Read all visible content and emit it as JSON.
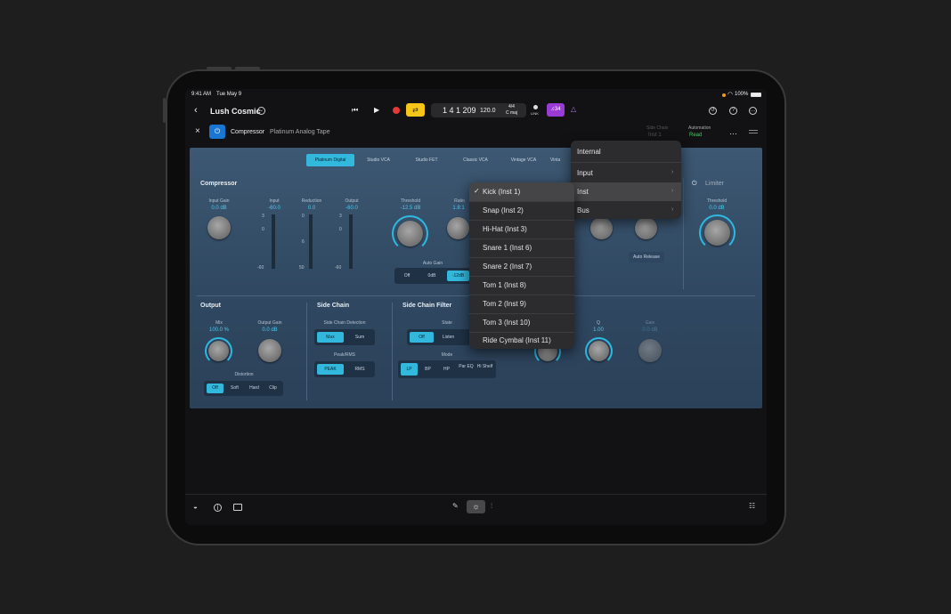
{
  "status": {
    "time": "9:41 AM",
    "date": "Tue May 9",
    "battery": "100%"
  },
  "topbar": {
    "project": "Lush Cosmic",
    "position": "1 4 1 209",
    "tempo": "120.0",
    "signature": "4/4",
    "key": "C maj",
    "link_label": "LINK",
    "count_in": "♫34"
  },
  "plugin_header": {
    "name": "Compressor",
    "preset": "Platinum Analog Tape",
    "sidechain_label": "Side Chain",
    "sidechain_value": "Inst 1",
    "automation_label": "Automation",
    "automation_value": "Read"
  },
  "tabs": [
    "Platinum Digital",
    "Studio VCA",
    "Studio FET",
    "Classic VCA",
    "Vintage VCA",
    "Vinta"
  ],
  "compressor": {
    "title": "Compressor",
    "input_gain": {
      "label": "Input Gain",
      "value": "0.0 dB"
    },
    "input": {
      "label": "Input",
      "value": "-60.0",
      "ticks": [
        "3",
        "0",
        "-60"
      ]
    },
    "reduction": {
      "label": "Reduction",
      "value": "0.0",
      "ticks": [
        "0",
        "6",
        "50"
      ]
    },
    "output": {
      "label": "Output",
      "value": "-60.0",
      "ticks": [
        "3",
        "0",
        "-60"
      ]
    },
    "threshold": {
      "label": "Threshold",
      "value": "-12.5 dB"
    },
    "ratio": {
      "label": "Ratio",
      "value": "1.8:1"
    },
    "auto_gain": {
      "label": "Auto Gain",
      "options": [
        "Off",
        "0dB",
        "-12dB"
      ],
      "selected": "-12dB"
    },
    "auto_release": "Auto Release"
  },
  "limiter": {
    "title": "Limiter",
    "threshold_label": "Threshold",
    "threshold_value": "0.0 dB"
  },
  "output_section": {
    "title": "Output",
    "mix": {
      "label": "Mix",
      "value": "100.0 %"
    },
    "output_gain": {
      "label": "Output Gain",
      "value": "0.0 dB"
    },
    "distortion": {
      "label": "Distortion",
      "options": [
        "Off",
        "Soft",
        "Hard",
        "Clip"
      ],
      "selected": "Off"
    }
  },
  "side_chain": {
    "title": "Side Chain",
    "detection_label": "Side Chain Detection",
    "detection_options": [
      "Max",
      "Sum"
    ],
    "detection_selected": "Max",
    "peakrms_label": "Peak/RMS",
    "peakrms_options": [
      "PEAK",
      "RMS"
    ],
    "peakrms_selected": "PEAK"
  },
  "sc_filter": {
    "title": "Side Chain Filter",
    "state_label": "State",
    "state_options": [
      "Off",
      "Listen"
    ],
    "state_selected": "Off",
    "mode_label": "Mode",
    "mode_options": [
      "LP",
      "BP",
      "HP",
      "Par EQ",
      "Hi Shelf"
    ],
    "mode_selected": "LP",
    "q_label": "Q",
    "q_value": "1.00",
    "gain_label": "Gain",
    "gain_value": "0.0 dB"
  },
  "source_menu": {
    "items": [
      {
        "label": "Internal",
        "submenu": false
      },
      {
        "label": "Input",
        "submenu": true
      },
      {
        "label": "Inst",
        "submenu": true
      },
      {
        "label": "Bus",
        "submenu": true
      }
    ],
    "highlighted": "Inst"
  },
  "inst_menu": {
    "checked": "Kick (Inst 1)",
    "items": [
      "Kick (Inst 1)",
      "Snap (Inst 2)",
      "Hi-Hat (Inst 3)",
      "Snare 1 (Inst 6)",
      "Snare 2 (Inst 7)",
      "Tom 1 (Inst 8)",
      "Tom 2 (Inst 9)",
      "Tom 3 (Inst 10)",
      "Ride Cymbal (Inst 11)"
    ]
  },
  "colors": {
    "accent": "#32b8dc",
    "record": "#e53935",
    "cycle": "#f5c518",
    "count_in": "#9b3bd6",
    "automation": "#3ccf5a"
  }
}
